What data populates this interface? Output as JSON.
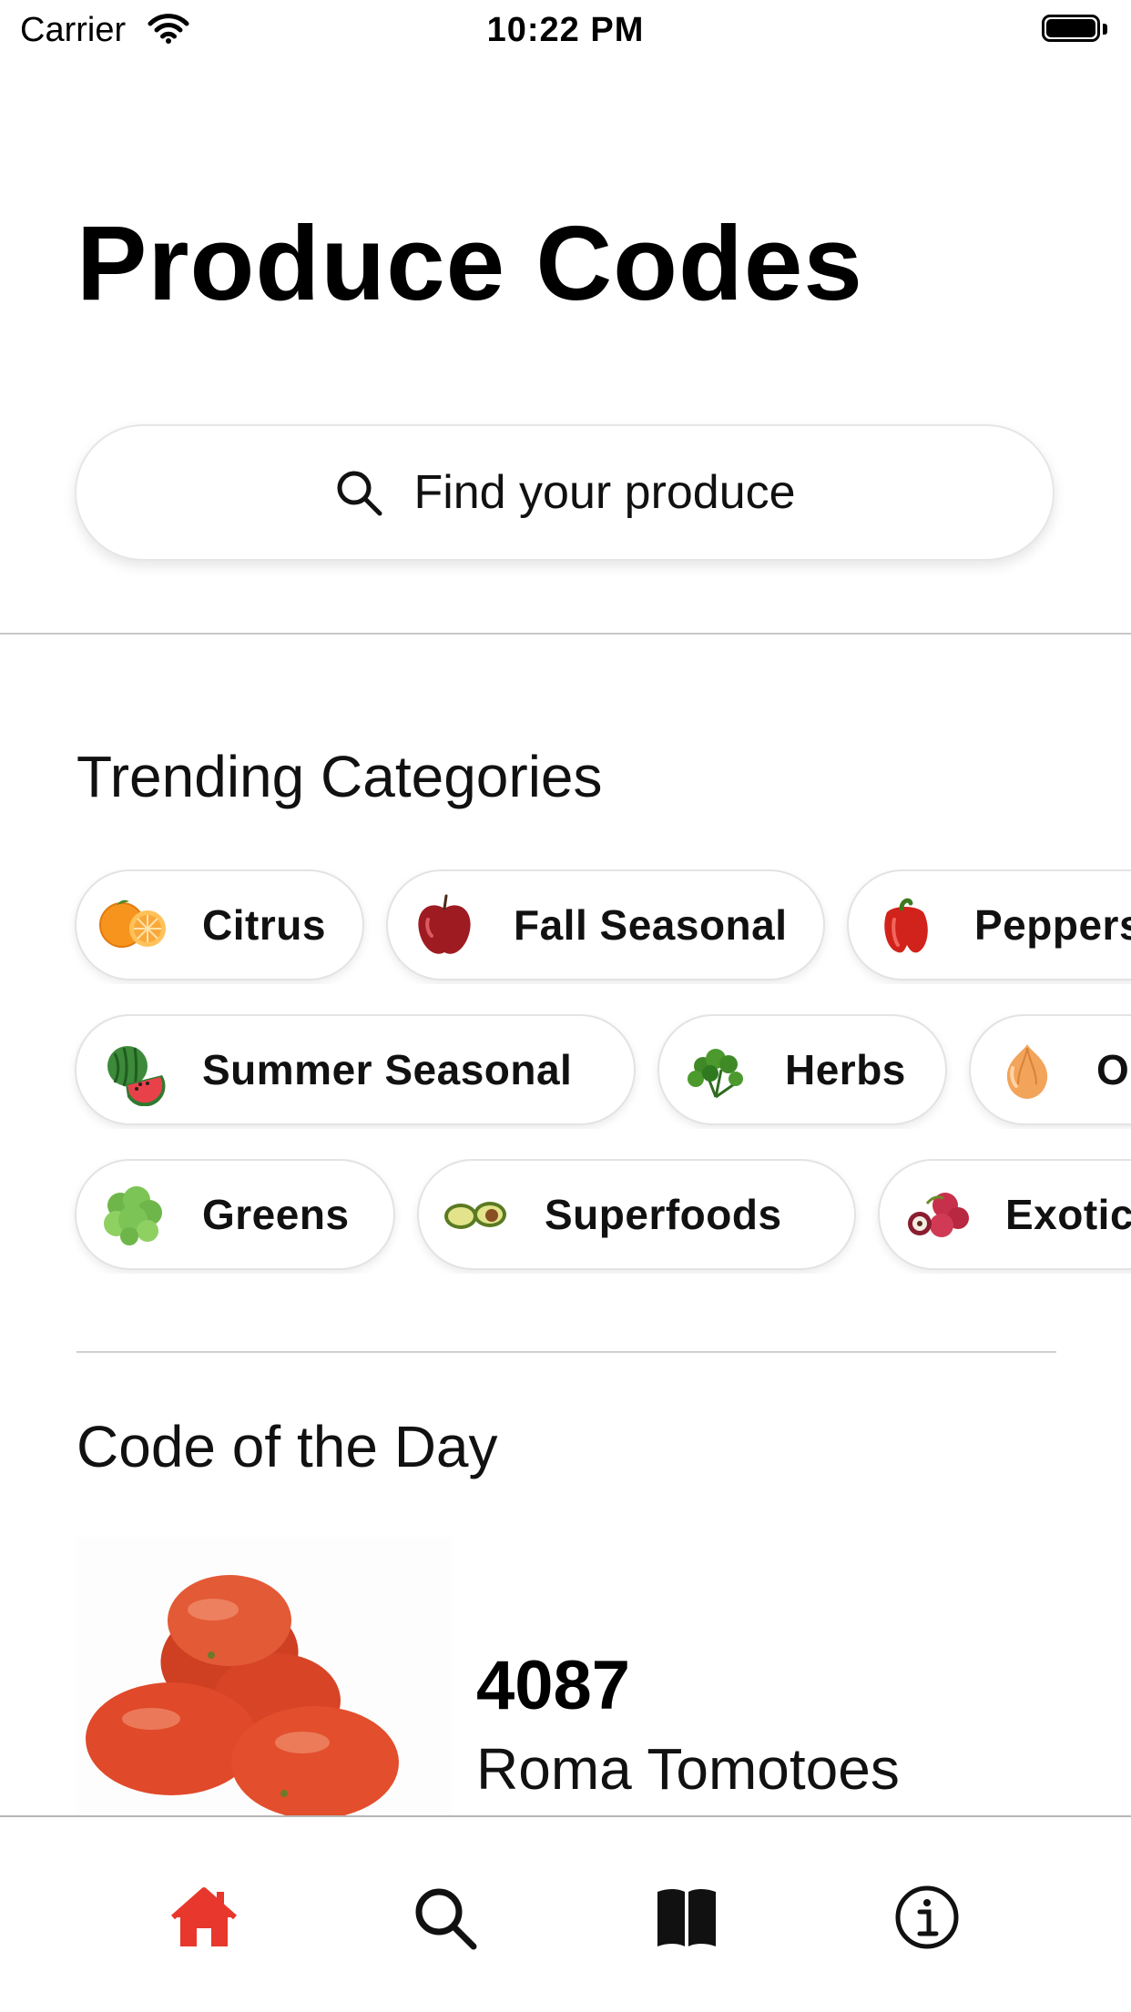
{
  "status_bar": {
    "carrier": "Carrier",
    "time": "10:22 PM"
  },
  "header": {
    "title": "Produce Codes"
  },
  "search": {
    "placeholder": "Find your produce",
    "icon": "search-icon"
  },
  "trending": {
    "title": "Trending Categories",
    "rows": [
      [
        {
          "label": "Citrus",
          "icon": "orange-icon"
        },
        {
          "label": "Fall Seasonal",
          "icon": "apple-icon"
        },
        {
          "label": "Peppers",
          "icon": "pepper-icon"
        }
      ],
      [
        {
          "label": "Summer Seasonal",
          "icon": "watermelon-icon"
        },
        {
          "label": "Herbs",
          "icon": "herb-icon"
        },
        {
          "label": "Onions",
          "icon": "onion-icon"
        }
      ],
      [
        {
          "label": "Greens",
          "icon": "lettuce-icon"
        },
        {
          "label": "Superfoods",
          "icon": "avocado-icon"
        },
        {
          "label": "Exotic",
          "icon": "lychee-icon"
        }
      ]
    ]
  },
  "code_of_the_day": {
    "title": "Code of the Day",
    "code": "4087",
    "name": "Roma Tomotoes"
  },
  "tab_bar": {
    "active_color": "#e8372c",
    "items": [
      {
        "icon": "home-icon",
        "active": true
      },
      {
        "icon": "search-icon",
        "active": false
      },
      {
        "icon": "book-icon",
        "active": false
      },
      {
        "icon": "info-icon",
        "active": false
      }
    ]
  }
}
